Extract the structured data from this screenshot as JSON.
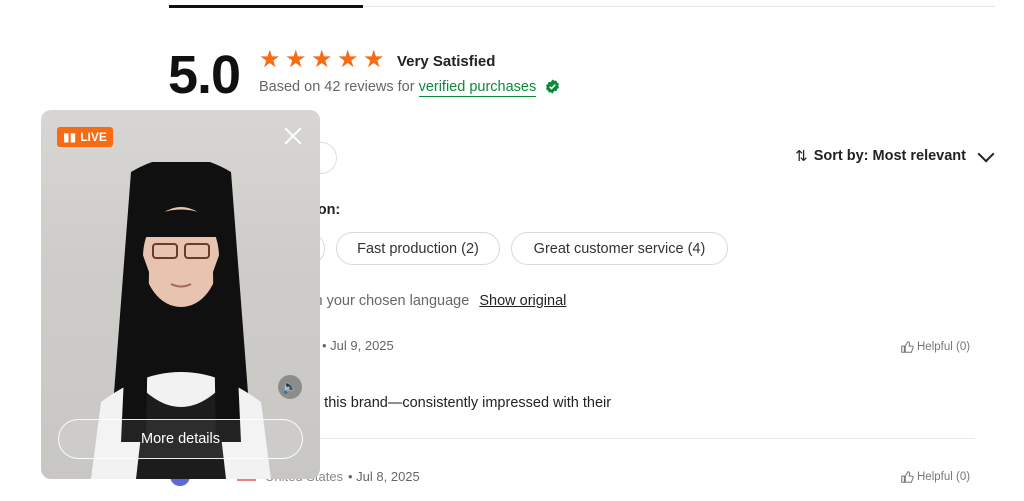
{
  "summary": {
    "score": "5.0",
    "rating_stars": 5,
    "rating_label": "Very Satisfied",
    "based_on": "Based on 42 reviews for",
    "verified_link": "verified purchases"
  },
  "sort": {
    "label": "Sort by: Most relevant"
  },
  "mentions": {
    "heading_visible": "ntion:",
    "chips": [
      {
        "label": "Fast production (2)"
      },
      {
        "label": "Great customer service (4)"
      }
    ]
  },
  "translation": {
    "notice_visible": "s in your chosen language",
    "show_original": "Show original"
  },
  "reviews": [
    {
      "date_visible": "• Jul 9, 2025",
      "text_visible": "om this brand—consistently impressed with their",
      "helpful": "Helpful (0)"
    },
    {
      "country_visible": "United States",
      "date_visible": "• Jul 8, 2025",
      "helpful": "Helpful (0)"
    }
  ],
  "live": {
    "badge": "LIVE",
    "more_details": "More details"
  },
  "colors": {
    "accent_orange": "#f76b15",
    "verified_green": "#0a8a3a"
  },
  "icons": {
    "star": "star-icon",
    "verified": "verified-badge-icon",
    "sort": "sort-arrows-icon",
    "chevron": "chevron-down-icon",
    "thumbs_up": "thumbs-up-icon",
    "close": "close-icon",
    "sound": "speaker-icon",
    "live": "live-bars-icon"
  }
}
